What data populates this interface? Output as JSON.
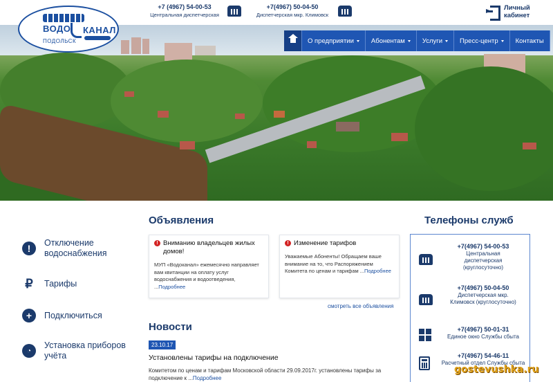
{
  "header": {
    "logo": {
      "line1": "ВОДО",
      "line2": "КАНАЛ",
      "city": "ПОДОЛЬСК"
    },
    "phones": [
      {
        "number": "+7 (4967) 54-00-53",
        "caption": "Центральная диспетчерская"
      },
      {
        "number": "+7(4967) 50-04-50",
        "caption": "Диспетчерская мкр. Климовск"
      }
    ],
    "cabinet_label": "Личный кабинет"
  },
  "nav": {
    "items": [
      {
        "label": "О предприятии",
        "dropdown": true
      },
      {
        "label": "Абонентам",
        "dropdown": true
      },
      {
        "label": "Услуги",
        "dropdown": true
      },
      {
        "label": "Пресс-центр",
        "dropdown": true
      },
      {
        "label": "Контакты",
        "dropdown": false
      }
    ]
  },
  "sidebar": {
    "items": [
      {
        "icon": "exclamation-icon",
        "label": "Отключение водоснабжения"
      },
      {
        "icon": "ruble-icon",
        "label": "Тарифы"
      },
      {
        "icon": "plus-icon",
        "label": "Подключиться"
      },
      {
        "icon": "gauge-icon",
        "label": "Установка приборов учёта"
      }
    ]
  },
  "announcements": {
    "heading": "Объявления",
    "cards": [
      {
        "title": "Вниманию владельцев жилых домов!",
        "text": "МУП «Водоканал» ежемесячно направляет вам квитанции на оплату услуг водоснабжения и водоотведения, ...",
        "more": "Подробнее"
      },
      {
        "title": "Изменение тарифов",
        "text": "Уважаемые Абоненты! Обращаем ваше внимание на то, что Распоряжением Комитета по ценам и тарифам ...",
        "more": "Подробнее"
      }
    ],
    "all_link": "смотреть все объявления"
  },
  "news": {
    "heading": "Новости",
    "date": "23.10.17",
    "title": "Установлены тарифы на подключение",
    "text": "Комитетом по ценам и тарифам Московской области 29.09.2017г. установлены тарифы за подключение к ...",
    "more": "Подробнее"
  },
  "services": {
    "heading": "Телефоны служб",
    "items": [
      {
        "icon": "phone-icon",
        "number": "+7(4967) 54-00-53",
        "caption": "Центральная диспетчерская (круглосуточно)"
      },
      {
        "icon": "phone-icon",
        "number": "+7(4967) 50-04-50",
        "caption": "Диспетчерская мкр. Климовск (круглосуточно)"
      },
      {
        "icon": "windows-icon",
        "number": "+7(4967) 50-01-31",
        "caption": "Единое окно Службы сбыта"
      },
      {
        "icon": "calculator-icon",
        "number": "+7(4967) 54-46-11",
        "caption": "Расчетный отдел Службы сбыта"
      }
    ]
  },
  "watermark": "gostevushka.ru",
  "colors": {
    "primary": "#1f56b3",
    "dark": "#1b3a6b",
    "alert": "#d32323"
  }
}
